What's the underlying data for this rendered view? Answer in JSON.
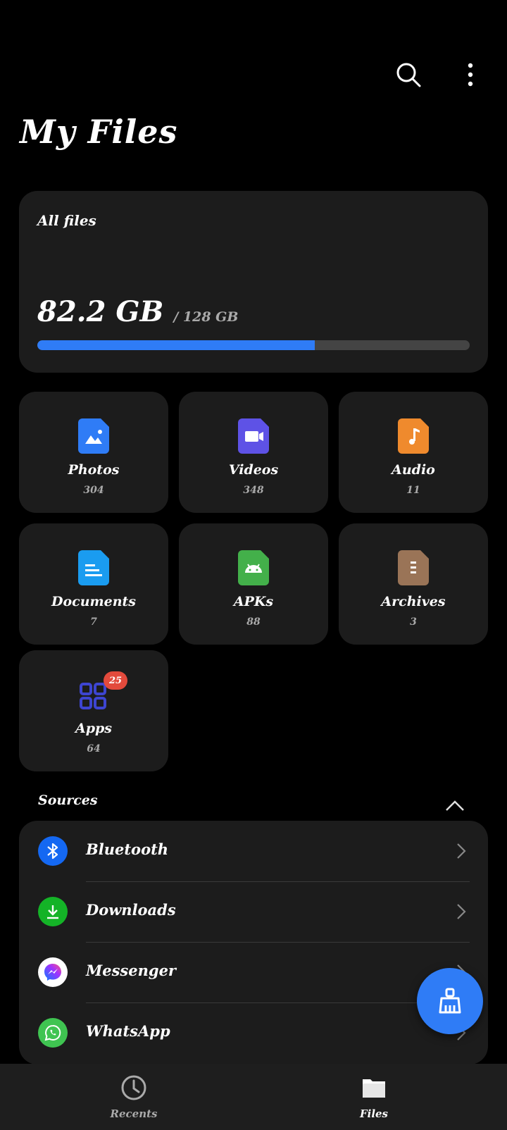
{
  "header": {
    "title": "My Files"
  },
  "storage": {
    "label": "All files",
    "used": "82.2 GB",
    "total": "/ 128 GB",
    "used_fraction": 0.642,
    "accent": "#2f7cf6"
  },
  "categories": [
    {
      "name": "Photos",
      "count": "304",
      "icon": "image-icon",
      "color": "#2f7cf6"
    },
    {
      "name": "Videos",
      "count": "348",
      "icon": "video-icon",
      "color": "#5e52e6"
    },
    {
      "name": "Audio",
      "count": "11",
      "icon": "music-icon",
      "color": "#ef8a2d"
    },
    {
      "name": "Documents",
      "count": "7",
      "icon": "document-icon",
      "color": "#1a9cf0"
    },
    {
      "name": "APKs",
      "count": "88",
      "icon": "android-icon",
      "color": "#43b04a"
    },
    {
      "name": "Archives",
      "count": "3",
      "icon": "archive-icon",
      "color": "#9a7457"
    },
    {
      "name": "Apps",
      "count": "64",
      "icon": "apps-grid-icon",
      "color": "#3d45d1",
      "badge": "25"
    }
  ],
  "sources": {
    "title": "Sources",
    "items": [
      {
        "label": "Bluetooth",
        "icon": "bluetooth-icon",
        "color": "#1468f2"
      },
      {
        "label": "Downloads",
        "icon": "download-icon",
        "color": "#14b327"
      },
      {
        "label": "Messenger",
        "icon": "messenger-icon",
        "color": "#ffffff"
      },
      {
        "label": "WhatsApp",
        "icon": "whatsapp-icon",
        "color": "#3fc451"
      }
    ]
  },
  "nav": {
    "recents": "Recents",
    "files": "Files"
  }
}
